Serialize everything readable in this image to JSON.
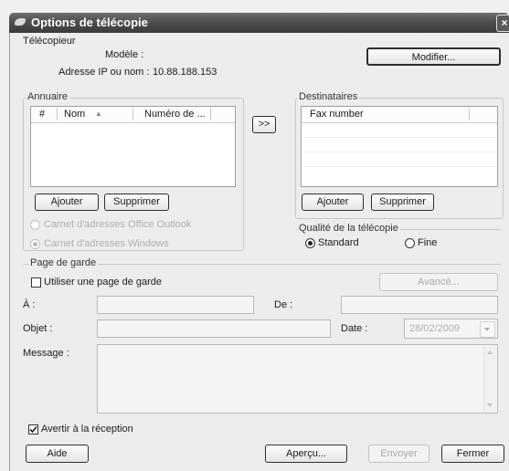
{
  "window": {
    "title": "Options de télécopie",
    "close": "×"
  },
  "telecopieur": {
    "group_label": "Télécopieur",
    "modele_label": "Modèle :",
    "modele_value": "",
    "adresse_label": "Adresse IP ou nom :",
    "adresse_value": "10.88.188.153",
    "modifier_button": "Modifier..."
  },
  "annuaire": {
    "group_label": "Annuaire",
    "columns": [
      "#",
      "Nom",
      "Numéro de ..."
    ],
    "sort_indicator": "▲",
    "add_button": "Ajouter",
    "delete_button": "Supprimer",
    "radio_outlook": "Carnet d'adresses Office Outlook",
    "radio_windows": "Carnet d'adresses Windows"
  },
  "transfer_button": ">>",
  "destinataires": {
    "group_label": "Destinataires",
    "column": "Fax number",
    "add_button": "Ajouter",
    "delete_button": "Supprimer"
  },
  "qualite": {
    "group_label": "Qualité de la télécopie",
    "standard_label": "Standard",
    "fine_label": "Fine",
    "selected": "Standard"
  },
  "page_garde": {
    "group_label": "Page de garde",
    "use_checkbox_label": "Utiliser une page de garde",
    "use_checked": false,
    "avance_button": "Avancé...",
    "a_label": "À :",
    "de_label": "De :",
    "objet_label": "Objet :",
    "date_label": "Date :",
    "date_value": "28/02/2009",
    "message_label": "Message :"
  },
  "avertir": {
    "label": "Avertir à la réception",
    "checked": true
  },
  "footer": {
    "aide": "Aide",
    "apercu": "Aperçu...",
    "envoyer": "Envoyer",
    "fermer": "Fermer"
  }
}
